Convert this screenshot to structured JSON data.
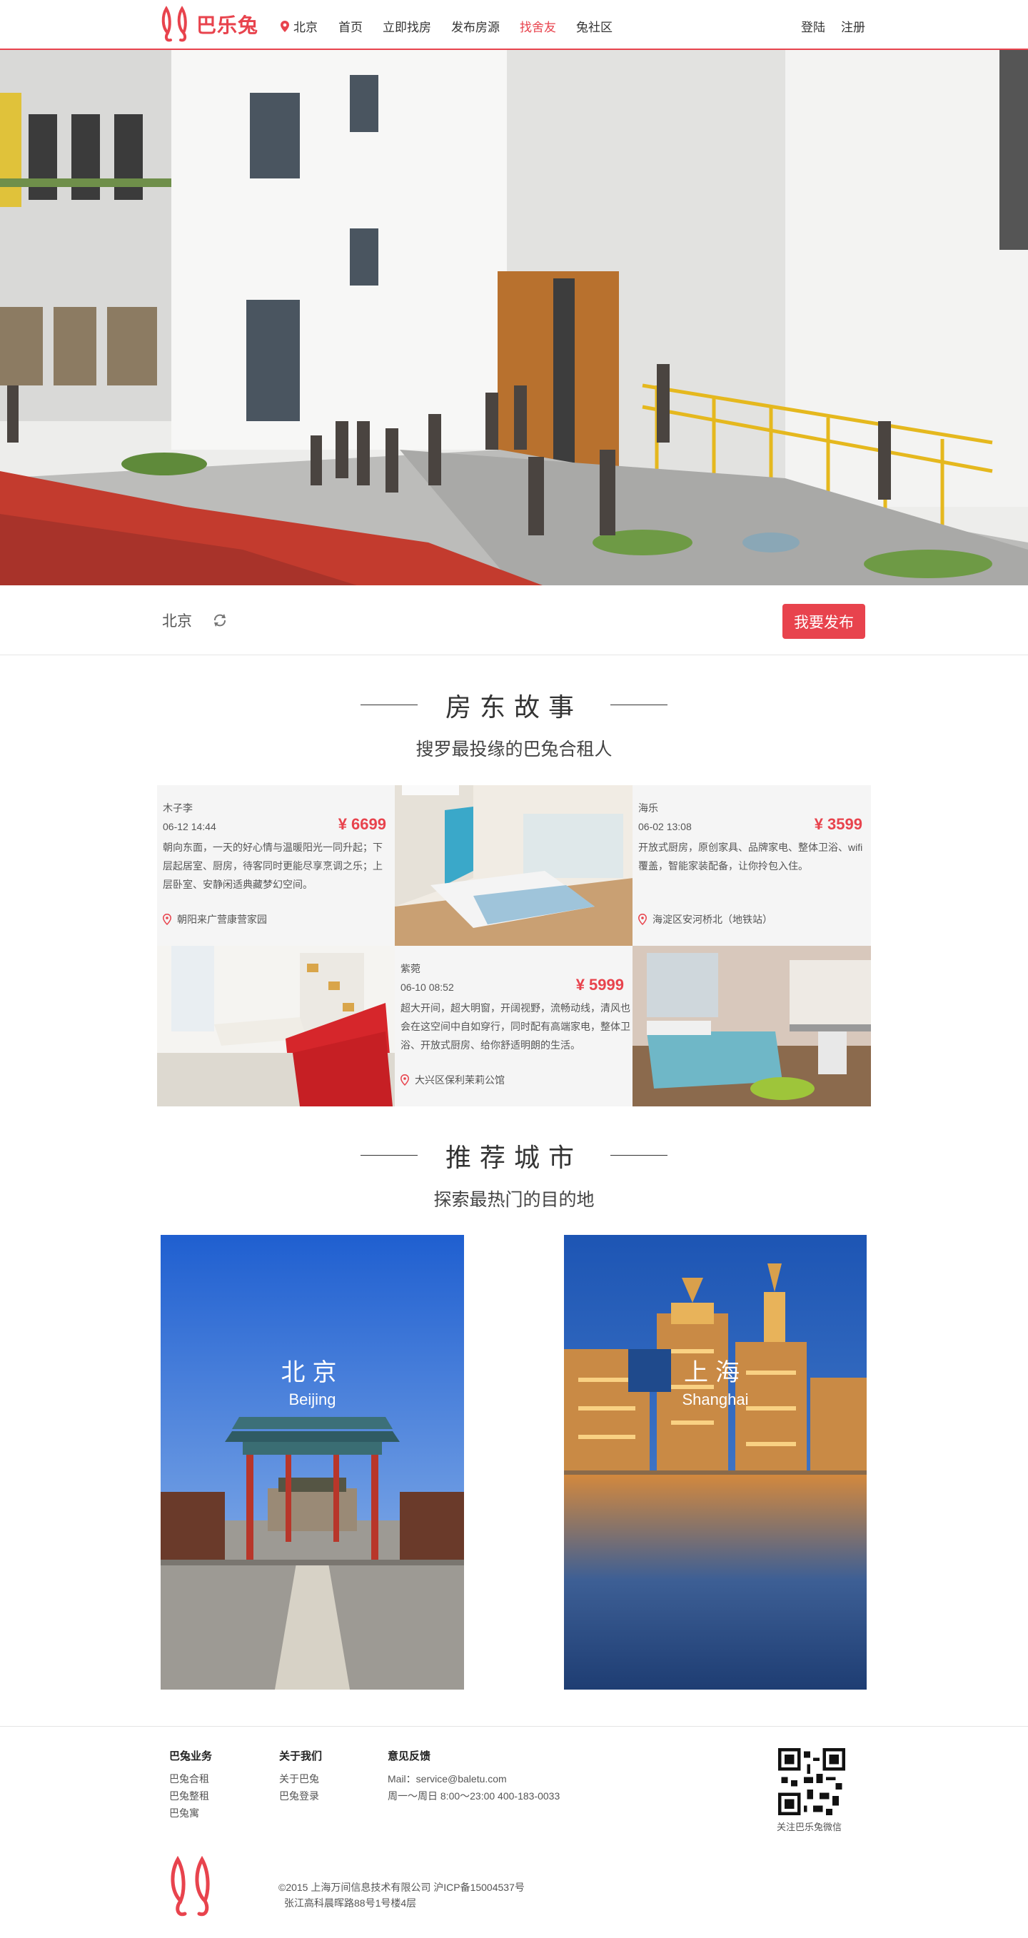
{
  "brand": {
    "name": "巴乐兔",
    "color": "#e8434d"
  },
  "nav": {
    "city": "北京",
    "links": [
      "首页",
      "立即找房",
      "发布房源",
      "找舍友",
      "兔社区"
    ],
    "active_index": 3,
    "login": "登陆",
    "register": "注册"
  },
  "citybar": {
    "city": "北京",
    "publish_label": "我要发布"
  },
  "stories": {
    "title": "房东故事",
    "subtitle": "搜罗最投缘的巴兔合租人",
    "cards": [
      {
        "name": "木子李",
        "date": "06-12   14:44",
        "price": "¥ 6699",
        "desc": "朝向东面，一天的好心情与温暖阳光一同升起；下层起居室、厨房，待客同时更能尽享烹调之乐；上层卧室、安静闲适典藏梦幻空间。",
        "location": "朝阳来广营康营家园"
      },
      {
        "name": "海乐",
        "date": "06-02   13:08",
        "price": "¥ 3599",
        "desc": "开放式厨房，原创家具、品牌家电、整体卫浴、wifi覆盖，智能家装配备，让你拎包入住。",
        "location": "海淀区安河桥北（地铁站）"
      },
      {
        "name": "紫菀",
        "date": "06-10   08:52",
        "price": "¥ 5999",
        "desc": "超大开间，超大明窗，开阔视野，流畅动线，清风也会在这空间中自如穿行，同时配有高端家电，整体卫浴、开放式厨房、给你舒适明朗的生活。",
        "location": "大兴区保利茉莉公馆"
      }
    ]
  },
  "cities": {
    "title": "推荐城市",
    "subtitle": "探索最热门的目的地",
    "items": [
      {
        "cn": "北京",
        "en": "Beijing"
      },
      {
        "cn": "上海",
        "en": "Shanghai"
      }
    ]
  },
  "footer": {
    "business": {
      "title": "巴兔业务",
      "items": [
        "巴兔合租",
        "巴兔整租",
        "巴兔寓"
      ]
    },
    "about": {
      "title": "关于我们",
      "items": [
        "关于巴兔",
        "巴兔登录"
      ]
    },
    "feedback": {
      "title": "意见反馈",
      "mail": "Mail：service@baletu.com",
      "hours": "周一～周日 8:00～23:00 400-183-0033"
    },
    "qr_caption": "关注巴乐兔微信",
    "copyright": "©2015 上海万间信息技术有限公司     沪ICP备15004537号",
    "address": "张江高科晨晖路88号1号楼4层"
  }
}
